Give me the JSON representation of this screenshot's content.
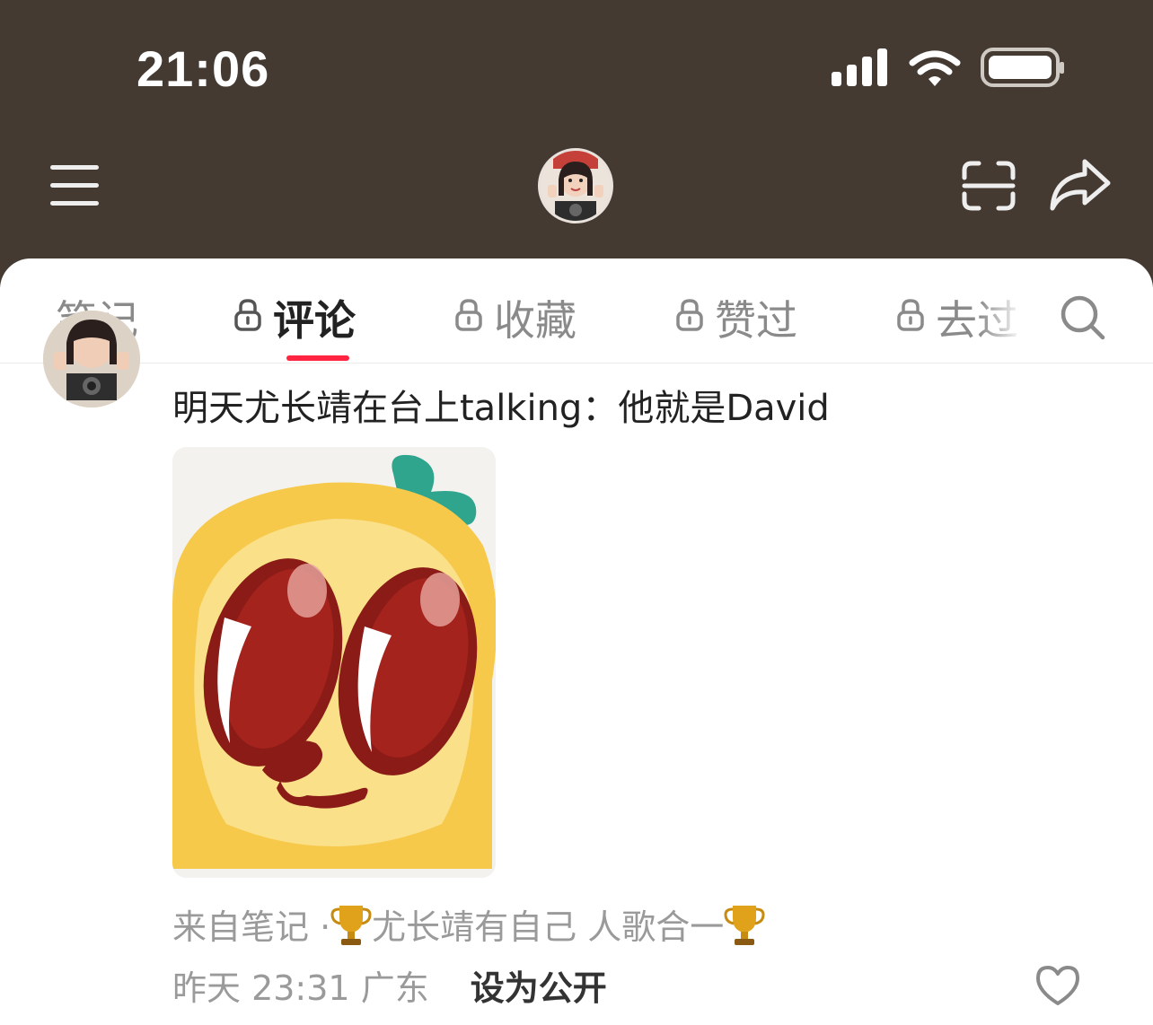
{
  "status_bar": {
    "time": "21:06"
  },
  "header": {
    "menu_icon": "hamburger-menu-icon",
    "avatar": "profile-avatar",
    "scan_icon": "scan-icon",
    "share_icon": "share-arrow-icon"
  },
  "tabs": [
    {
      "label": "笔记",
      "locked": false,
      "active": false
    },
    {
      "label": "评论",
      "locked": true,
      "active": true
    },
    {
      "label": "收藏",
      "locked": true,
      "active": false
    },
    {
      "label": "赞过",
      "locked": true,
      "active": false
    },
    {
      "label": "去过",
      "locked": true,
      "active": false
    }
  ],
  "comment": {
    "text": "明天尤长靖在台上talking：他就是David",
    "sticker": "yellow-emoji-sticker",
    "source_prefix": "来自笔记 · ",
    "source_title": "尤长靖有自己 人歌合一",
    "time": "昨天 23:31",
    "location": "广东",
    "make_public": "设为公开"
  },
  "colors": {
    "header_bg": "#453a32",
    "accent": "#ff2442"
  }
}
